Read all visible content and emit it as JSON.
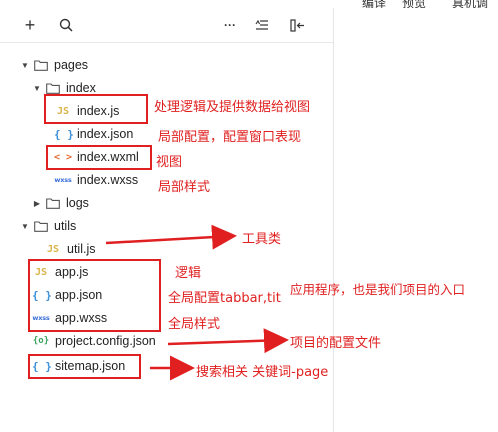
{
  "topbar": {
    "items": [
      "编译",
      "预览",
      "真机调试"
    ]
  },
  "toolbar": {
    "add_label": "+",
    "more_label": "···"
  },
  "tree": {
    "pages": "pages",
    "index": "index",
    "index_js": "index.js",
    "index_json": "index.json",
    "index_wxml": "index.wxml",
    "index_wxss": "index.wxss",
    "logs": "logs",
    "utils": "utils",
    "util_js": "util.js",
    "app_js": "app.js",
    "app_json": "app.json",
    "app_wxss": "app.wxss",
    "project_config": "project.config.json",
    "sitemap": "sitemap.json"
  },
  "icons": {
    "js": "JS",
    "json": "{ }",
    "wxml": "< >",
    "wxss": "wxss",
    "config": "{o}"
  },
  "annotations": {
    "index_js": "处理逻辑及提供数据给视图",
    "index_json": "局部配置，配置窗口表现",
    "index_wxml": "视图",
    "index_wxss": "局部样式",
    "util_js": "工具类",
    "app_js": "逻辑",
    "app_json": "全局配置tabbar,tit",
    "app_wxss": "全局样式",
    "app_group": "应用程序，也是我们项目的入口",
    "project_config": "项目的配置文件",
    "sitemap": "搜索相关 关键词-page"
  },
  "colors": {
    "annotation": "#e02020",
    "js_icon": "#d9b44a",
    "json_icon": "#3b8fd6",
    "wxml_icon": "#e46b35"
  }
}
